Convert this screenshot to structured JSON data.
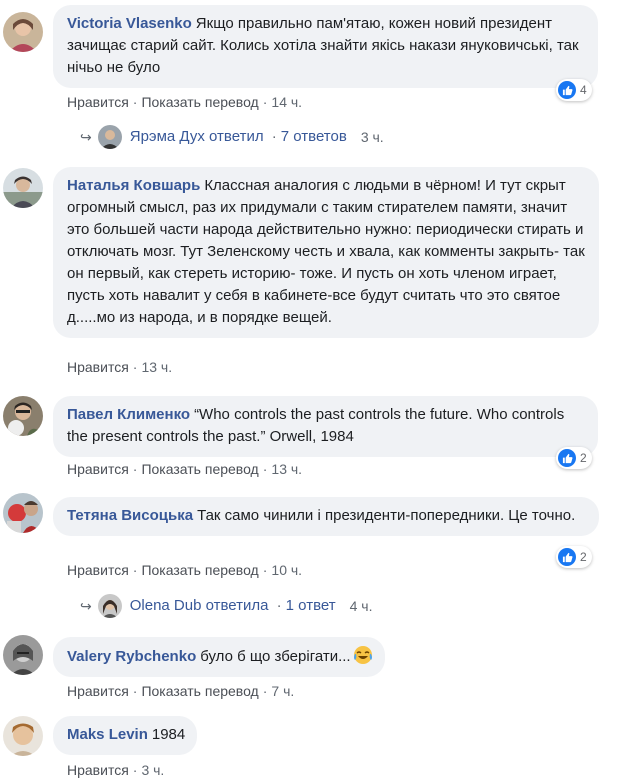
{
  "comments": [
    {
      "author": "Victoria Vlasenko",
      "text": "Якщо правильно пам'ятаю, кожен новий президент зачищає старий сайт. Колись хотіла знайти якісь накази януковичські, так нічьо не було",
      "like": "Нравится",
      "translate": "Показать перевод",
      "time": "14 ч.",
      "reactions": "4",
      "reply": {
        "name": "Ярэма Дух",
        "verb": "ответил",
        "count": "7 ответов",
        "time": "3 ч."
      }
    },
    {
      "author": "Наталья Ковшарь",
      "text": "Классная аналогия с людьми в чёрном! И тут скрыт огромный смысл, раз их придумали с таким стирателем памяти, значит это большей части народа действительно нужно: периодически стирать и отключать мозг. Тут Зеленскому честь и хвала, как комменты закрыть- так он первый, как стереть историю- тоже. И пусть он хоть членом играет, пусть хоть навалит у себя в кабинете-все будут считать что это святое д.....мо из народа, и в порядке вещей.",
      "like": "Нравится",
      "time": "13 ч."
    },
    {
      "author": "Павел Клименко",
      "text": "“Who controls the past controls the future. Who controls the present controls the past.” Orwell, 1984",
      "like": "Нравится",
      "translate": "Показать перевод",
      "time": "13 ч.",
      "reactions": "2"
    },
    {
      "author": "Тетяна Висоцька",
      "text": "Так само чинили і президенти-попередники. Це точно.",
      "like": "Нравится",
      "translate": "Показать перевод",
      "time": "10 ч.",
      "reactions": "2",
      "reply": {
        "name": "Olena Dub",
        "verb": "ответила",
        "count": "1 ответ",
        "time": "4 ч."
      }
    },
    {
      "author": "Valery Rybchenko",
      "text": "було б що зберігати...",
      "emoji": "crying-laughing-emoji",
      "like": "Нравится",
      "translate": "Показать перевод",
      "time": "7 ч."
    },
    {
      "author": "Maks Levin",
      "text": "1984",
      "like": "Нравится",
      "time": "3 ч."
    }
  ],
  "colors": {
    "author": "#385898",
    "bubble": "#f0f2f5",
    "like_badge": "#1877f2",
    "meta": "#606770"
  }
}
